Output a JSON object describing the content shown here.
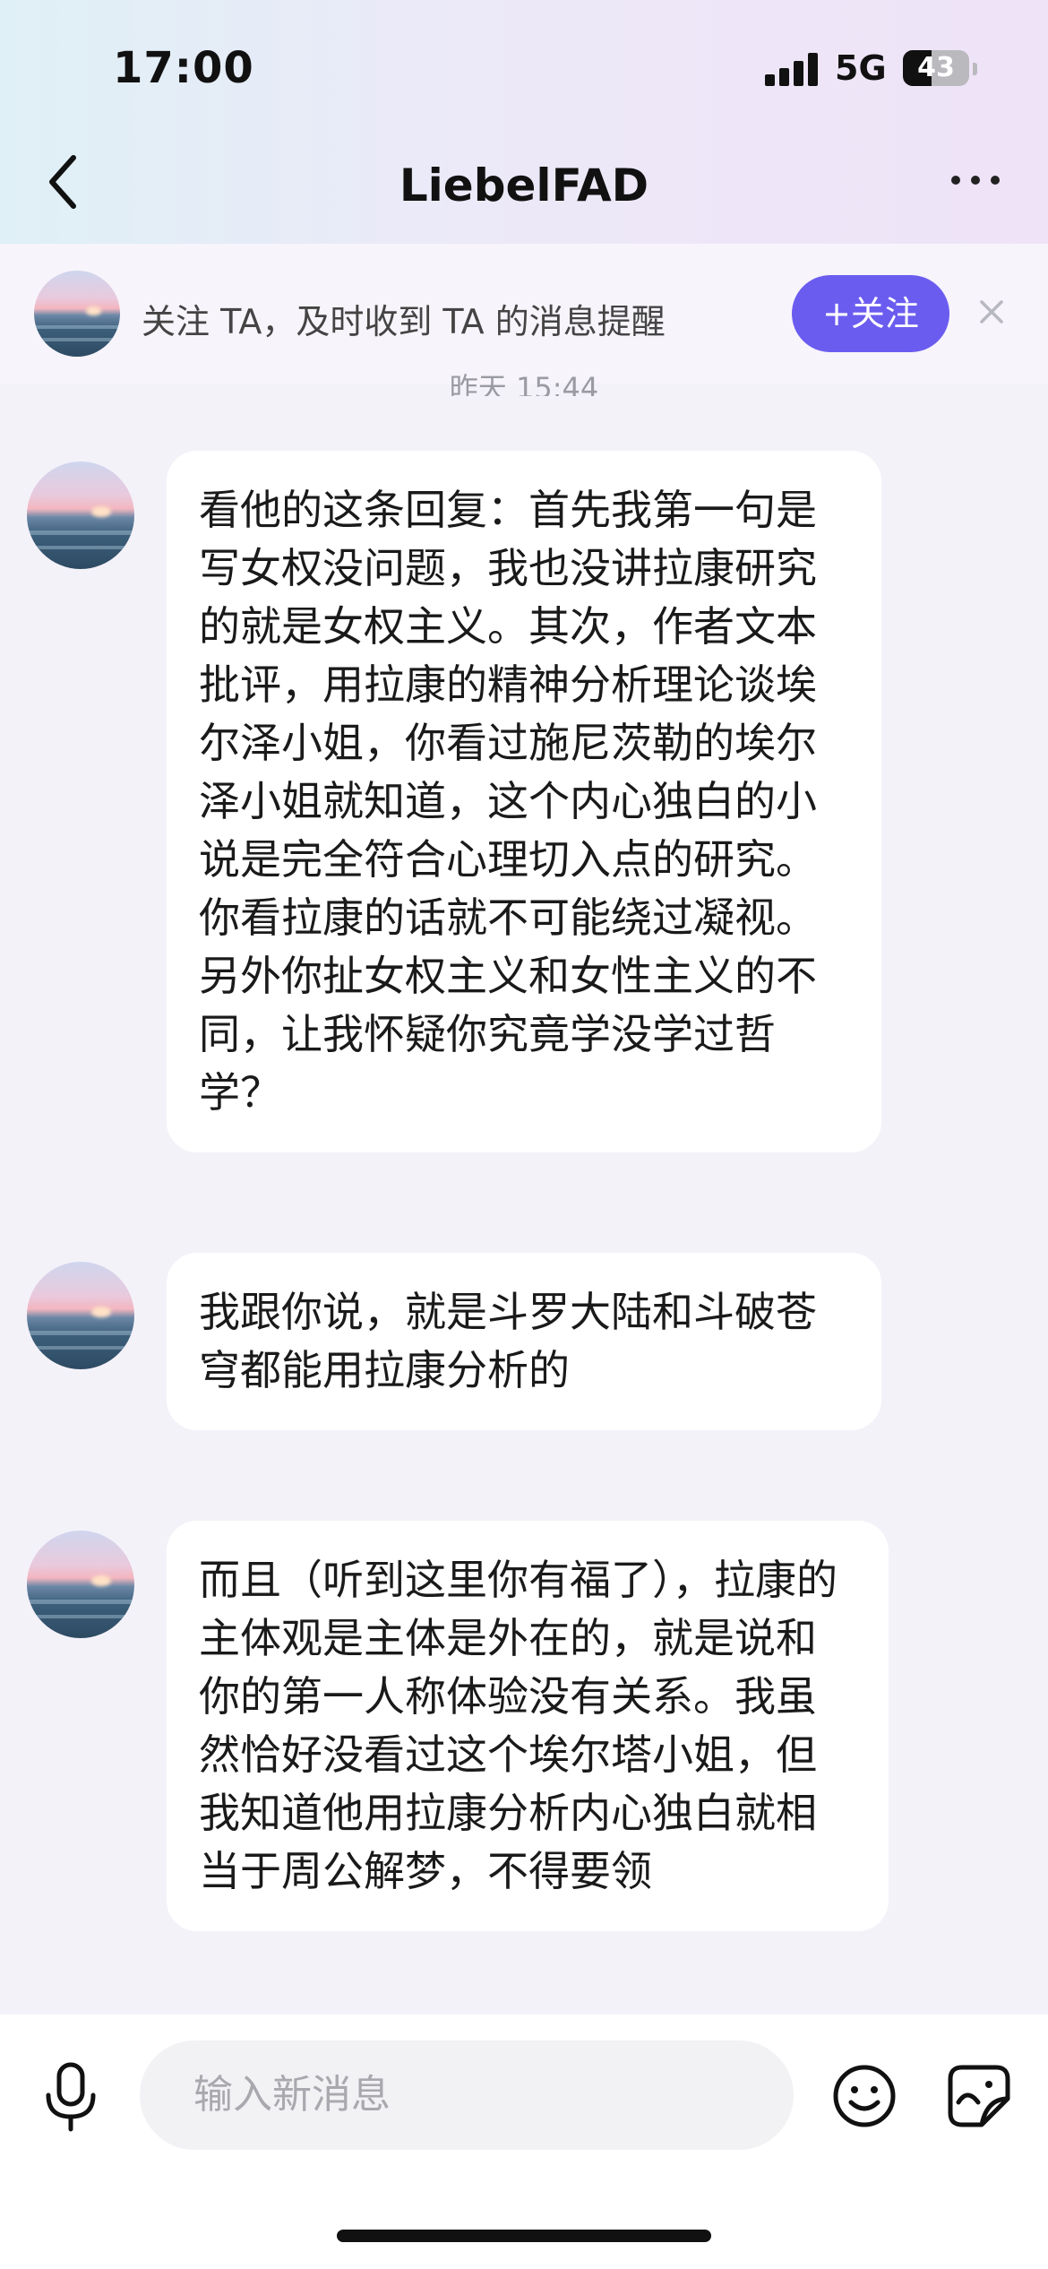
{
  "status_bar": {
    "time": "17:00",
    "network": "5G",
    "battery": "43",
    "battery_level_percent": 43
  },
  "nav": {
    "title": "LiebelFAD"
  },
  "follow_banner": {
    "text": "关注 TA，及时收到 TA 的消息提醒",
    "button_label": "+关注"
  },
  "timestamp": "昨天 15:44",
  "messages": [
    {
      "text": "看他的这条回复：首先我第一句是写女权没问题，我也没讲拉康研究的就是女权主义。其次，作者文本批评，用拉康的精神分析理论谈埃尔泽小姐，你看过施尼茨勒的埃尔泽小姐就知道，这个内心独白的小说是完全符合心理切入点的研究。你看拉康的话就不可能绕过凝视。另外你扯女权主义和女性主义的不同，让我怀疑你究竟学没学过哲学？"
    },
    {
      "text": "我跟你说，就是斗罗大陆和斗破苍穹都能用拉康分析的"
    },
    {
      "text": "而且（听到这里你有福了），拉康的主体观是主体是外在的，就是说和你的第一人称体验没有关系。我虽然恰好没看过这个埃尔塔小姐，但我知道他用拉康分析内心独白就相当于周公解梦，不得要领"
    }
  ],
  "input": {
    "placeholder": "输入新消息"
  },
  "icons": {
    "back": "chevron-left-icon",
    "more": "more-dots-icon",
    "close": "close-icon",
    "mic": "microphone-icon",
    "emoji": "smiley-icon",
    "sticker": "sticker-icon"
  },
  "colors": {
    "accent": "#6b5cf0",
    "bubble": "#ffffff",
    "background": "#f4f2f9"
  }
}
